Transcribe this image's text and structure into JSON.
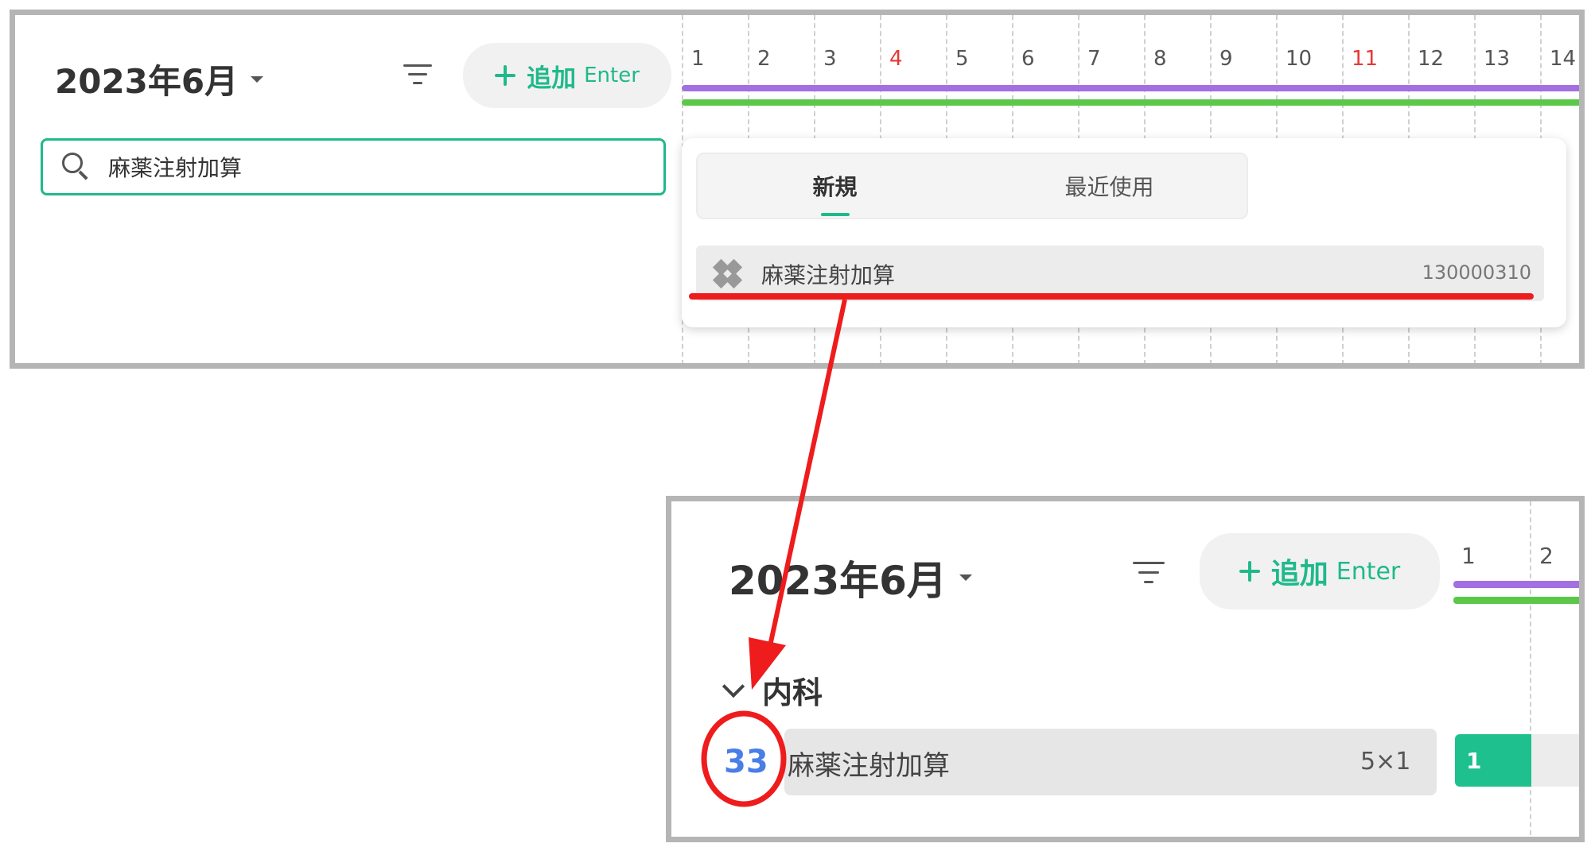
{
  "top_panel": {
    "month_label": "2023年6月",
    "add_button": {
      "label": "追加",
      "hint": "Enter"
    },
    "timeline_days": [
      {
        "n": "1",
        "weekend": false
      },
      {
        "n": "2",
        "weekend": false
      },
      {
        "n": "3",
        "weekend": false
      },
      {
        "n": "4",
        "weekend": true
      },
      {
        "n": "5",
        "weekend": false
      },
      {
        "n": "6",
        "weekend": false
      },
      {
        "n": "7",
        "weekend": false
      },
      {
        "n": "8",
        "weekend": false
      },
      {
        "n": "9",
        "weekend": false
      },
      {
        "n": "10",
        "weekend": false
      },
      {
        "n": "11",
        "weekend": true
      },
      {
        "n": "12",
        "weekend": false
      },
      {
        "n": "13",
        "weekend": false
      },
      {
        "n": "14",
        "weekend": false
      }
    ],
    "search": {
      "value": "麻薬注射加算"
    },
    "dropdown": {
      "tabs": [
        {
          "label": "新規",
          "active": true
        },
        {
          "label": "最近使用",
          "active": false
        }
      ],
      "result": {
        "name": "麻薬注射加算",
        "code": "130000310",
        "icon": "bandage-icon"
      }
    }
  },
  "bottom_panel": {
    "month_label": "2023年6月",
    "add_button": {
      "label": "追加",
      "hint": "Enter"
    },
    "timeline_days": [
      {
        "n": "1"
      },
      {
        "n": "2"
      }
    ],
    "group": {
      "name": "内科"
    },
    "row": {
      "count": "33",
      "name": "麻薬注射加算",
      "dosage": "5×1",
      "day_value": "1"
    }
  },
  "colors": {
    "accent": "#1fb98a",
    "purple_bar": "#a270e0",
    "green_bar": "#5bc84a",
    "annotation_red": "#ee1c1c",
    "count_blue": "#4a7de6"
  }
}
